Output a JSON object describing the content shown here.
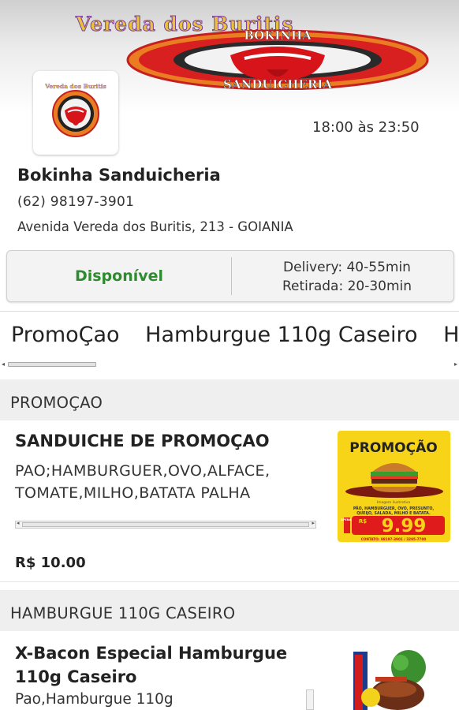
{
  "banner": {
    "title": "Vereda dos Buritis",
    "logo_top_text": "BOKINHA",
    "logo_bottom_text": "SANDUICHERIA"
  },
  "store": {
    "logo_text": "Vereda dos Buritis",
    "hours": "18:00 às 23:50",
    "name": "Bokinha Sanduicheria",
    "phone": "(62) 98197-3901",
    "address": "Avenida Vereda dos Buritis, 213 - GOIANIA"
  },
  "status": {
    "availability": "Disponível",
    "delivery": "Delivery: 40-55min",
    "pickup": "Retirada: 20-30min",
    "availability_color": "#2e8b2e"
  },
  "tabs": [
    "PromoÇao",
    "Hamburgue 110g Caseiro",
    "Ha"
  ],
  "sections": [
    {
      "title": "PROMOÇAO",
      "products": [
        {
          "name": "SANDUICHE DE PROMOÇAO",
          "description_lines": [
            "PAO;HAMBURGUER,OVO,ALFACE,",
            "TOMATE,MILHO,BATATA PALHA"
          ],
          "price": "R$ 10.00",
          "image": {
            "heading": "PROMOÇÃO",
            "caption": "Imagem ilustrativa",
            "ingredients_line1": "PÃO, HAMBURGUER, OVO, PRESUNTO,",
            "ingredients_line2": "QUEIJO, SALADA, MILHO E BATATA.",
            "price_prefix": "R$",
            "price_tag_label": "APENAS",
            "price": "9.99",
            "contact": "CONTATO: 98197-3901 / 3295-7700"
          }
        }
      ]
    },
    {
      "title": "HAMBURGUE 110G CASEIRO",
      "products": [
        {
          "name_lines": [
            "X-Bacon Especial Hamburgue",
            "110g Caseiro"
          ],
          "description_first_line": "Pao,Hamburgue 110g"
        }
      ]
    }
  ],
  "colors": {
    "promo_yellow": "#f7d417",
    "promo_red": "#e01b1b",
    "section_bg": "#efefef"
  }
}
